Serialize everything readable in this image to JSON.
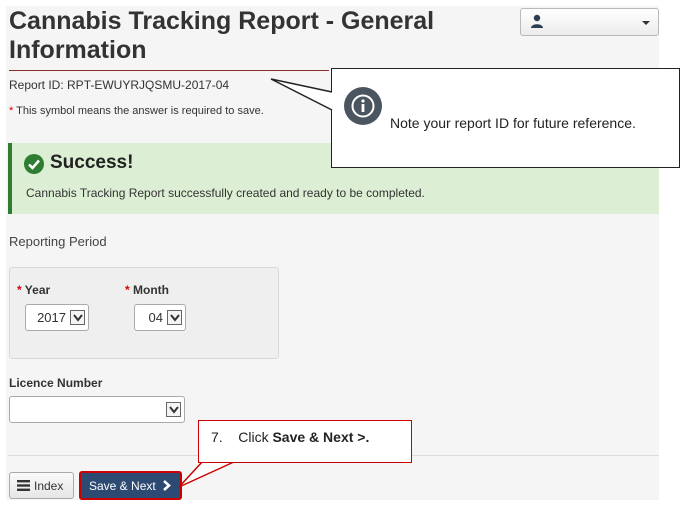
{
  "page": {
    "title": "Cannabis Tracking Report - General Information",
    "report_id": "Report ID: RPT-EWUYRJQSMU-2017-04",
    "required_note_star": "*",
    "required_note": "This symbol means the answer is required to save."
  },
  "user_menu": {
    "icon": "user-icon",
    "caret": "chevron-down-icon"
  },
  "callout_report": {
    "icon": "info-icon",
    "text": "Note your report ID for future reference."
  },
  "success": {
    "icon": "check-circle-icon",
    "title": "Success!",
    "message": "Cannabis Tracking Report successfully created and ready to be completed.",
    "color": "#2e7d32",
    "background": "#dcefd4"
  },
  "reporting_period": {
    "label": "Reporting Period",
    "year_label": "Year",
    "year_value": "2017",
    "month_label": "Month",
    "month_value": "04",
    "required_star": "*"
  },
  "licence": {
    "label": "Licence Number",
    "value": ""
  },
  "actions": {
    "index_label": "Index",
    "index_icon": "list-icon",
    "save_next_label": "Save & Next",
    "save_next_icon": "chevron-right-icon",
    "save_color": "#2c4a72"
  },
  "step_callout": {
    "prefix": "7.    Click ",
    "bold": "Save & Next >."
  }
}
